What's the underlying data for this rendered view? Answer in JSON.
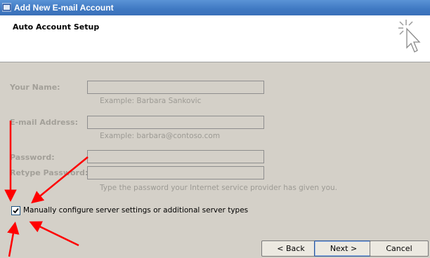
{
  "window": {
    "title": "Add New E-mail Account"
  },
  "header": {
    "title": "Auto Account Setup",
    "icon": "wizard-pointer-icon"
  },
  "form": {
    "name": {
      "label": "Your Name:",
      "value": "",
      "hint": "Example: Barbara Sankovic"
    },
    "email": {
      "label": "E-mail Address:",
      "value": "",
      "hint": "Example: barbara@contoso.com"
    },
    "password": {
      "label": "Password:",
      "value": ""
    },
    "retype_password": {
      "label": "Retype Password:",
      "value": "",
      "hint": "Type the password your Internet service provider has given you."
    }
  },
  "manual_config": {
    "label": "Manually configure server settings or additional server types",
    "checked": true
  },
  "buttons": {
    "back": "< Back",
    "next": "Next >",
    "cancel": "Cancel"
  },
  "colors": {
    "titlebar": "#3f78c2",
    "annotation_arrow": "#ff0000",
    "dialog_bg": "#d4d0c8"
  }
}
